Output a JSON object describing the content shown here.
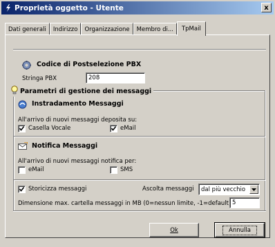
{
  "window": {
    "title": "Proprietà oggetto - Utente",
    "close_label": "x"
  },
  "tabs": [
    {
      "label": "Dati generali"
    },
    {
      "label": "Indirizzo"
    },
    {
      "label": "Organizzazione"
    },
    {
      "label": "Membro di..."
    },
    {
      "label": "TpMail",
      "active": true
    }
  ],
  "pbx": {
    "heading": "Codice di Postselezione PBX",
    "field_label": "Stringa PBX",
    "field_value": "208"
  },
  "messages_group": {
    "heading": "Parametri di gestione dei messaggi",
    "routing": {
      "heading": "Instradamento Messaggi",
      "prompt": "All'arrivo di nuovi messaggi deposita su:",
      "voicemail_label": "Casella Vocale",
      "voicemail_checked": true,
      "email_label": "eMail",
      "email_checked": true
    },
    "notify": {
      "heading": "Notifica Messaggi",
      "prompt": "All'arrivo di nuovi messaggi notifica per:",
      "email_label": "eMail",
      "email_checked": false,
      "sms_label": "SMS",
      "sms_checked": false
    },
    "history": {
      "store_label": "Storicizza messaggi",
      "store_checked": true,
      "listen_label": "Ascolta messaggi",
      "listen_selected": "dal più vecchio",
      "size_label": "Dimensione max. cartella messaggi in MB (0=nessun limite, -1=default)",
      "size_value": "5"
    }
  },
  "buttons": {
    "ok_label": "Ok",
    "cancel_label": "Annulla"
  },
  "colors": {
    "face": "#d4d0c8",
    "title_start": "#0a246a",
    "title_end": "#a6caf0"
  }
}
